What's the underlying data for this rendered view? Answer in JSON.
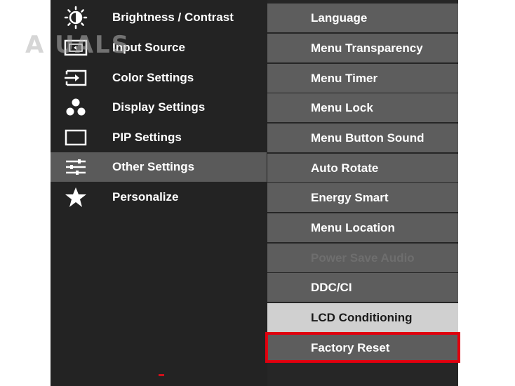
{
  "watermark": "A   UALS",
  "colors": {
    "highlight": "#e0000f",
    "active_item": "#5a5a5a",
    "selected_item": "#d0d0d0"
  },
  "left_menu": [
    {
      "label": "Brightness / Contrast",
      "icon": "brightness-icon"
    },
    {
      "label": "Input Source",
      "icon": "input-source-icon"
    },
    {
      "label": "Color Settings",
      "icon": "color-settings-icon"
    },
    {
      "label": "Display Settings",
      "icon": "display-settings-icon"
    },
    {
      "label": "PIP Settings",
      "icon": "pip-icon"
    },
    {
      "label": "Other Settings",
      "icon": "sliders-icon",
      "active": true
    },
    {
      "label": "Personalize",
      "icon": "star-icon"
    }
  ],
  "right_menu": [
    {
      "label": "Language"
    },
    {
      "label": "Menu Transparency"
    },
    {
      "label": "Menu Timer"
    },
    {
      "label": "Menu Lock"
    },
    {
      "label": "Menu Button Sound"
    },
    {
      "label": "Auto Rotate"
    },
    {
      "label": "Energy Smart"
    },
    {
      "label": "Menu Location"
    },
    {
      "label": "Power Save Audio",
      "disabled": true
    },
    {
      "label": "DDC/CI"
    },
    {
      "label": "LCD Conditioning",
      "selected": true
    },
    {
      "label": "Factory Reset",
      "highlighted": true
    }
  ]
}
